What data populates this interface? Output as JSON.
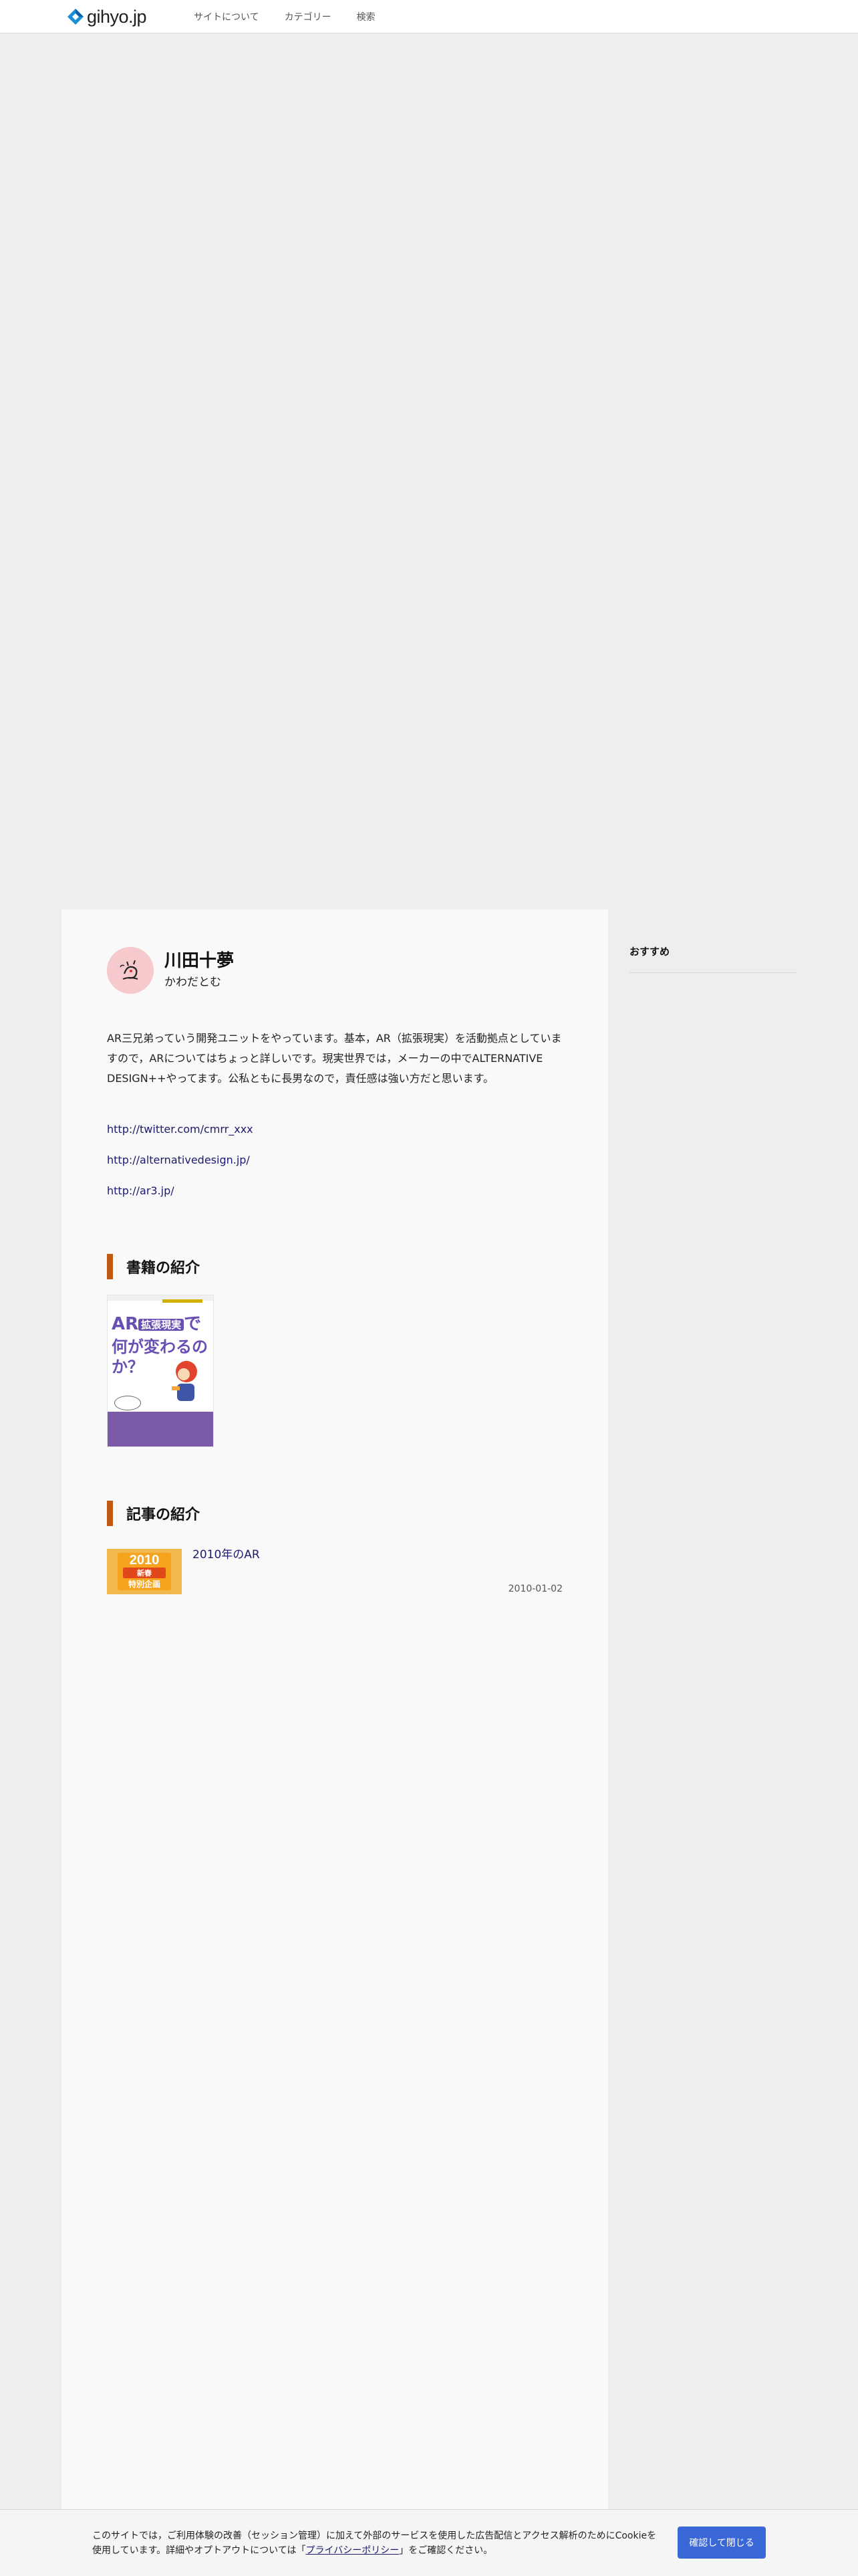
{
  "header": {
    "logo_text": "gihyo.jp",
    "nav": [
      "サイトについて",
      "カテゴリー",
      "検索"
    ]
  },
  "profile": {
    "name": "川田十夢",
    "kana": "かわだとむ",
    "bio": "AR三兄弟っていう開発ユニットをやっています。基本，AR（拡張現実）を活動拠点としていますので，ARについてはちょっと詳しいです。現実世界では，メーカーの中でALTERNATIVE DESIGN++やってます。公私ともに長男なので，責任感は強い方だと思います。",
    "links": [
      "http://twitter.com/cmrr_xxx",
      "http://alternativedesign.jp/",
      "http://ar3.jp/"
    ]
  },
  "books": {
    "heading": "書籍の紹介",
    "cover": {
      "line1": "AR",
      "pill": "拡張現実",
      "line1_end": "で",
      "line2": "何が変わるのか？"
    }
  },
  "articles": {
    "heading": "記事の紹介",
    "items": [
      {
        "title": "2010年のAR",
        "date": "2010-01-02",
        "thumb_year": "2010",
        "thumb_band": "新春",
        "thumb_text": "特別企画"
      }
    ]
  },
  "sidebar": {
    "title": "おすすめ"
  },
  "cookie": {
    "text_before": "このサイトでは，ご利用体験の改善（セッション管理）に加えて外部のサービスを使用した広告配信とアクセス解析のためにCookieを使用しています。詳細やオプトアウトについては「",
    "link": "プライバシーポリシー",
    "text_after": "」をご確認ください。",
    "button": "確認して閉じる"
  },
  "colors": {
    "accent_bar": "#c05a12",
    "link": "#1a1a6e",
    "button": "#3a67d6",
    "avatar_bg": "#f6c9cc"
  }
}
